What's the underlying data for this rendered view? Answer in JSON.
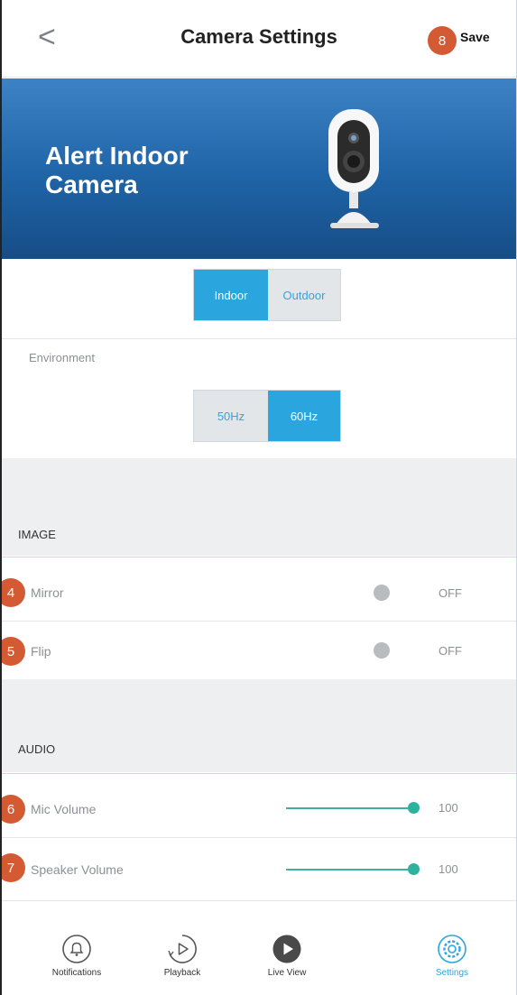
{
  "header": {
    "back_label": "<",
    "title": "Camera Settings",
    "save_label": "Save"
  },
  "callouts": {
    "save": "8",
    "mirror": "4",
    "flip": "5",
    "mic": "6",
    "speaker": "7"
  },
  "banner": {
    "camera_name_line1": "Alert Indoor",
    "camera_name_line2": "Camera",
    "background_color": "#2a6fb0"
  },
  "location": {
    "options": [
      "Indoor",
      "Outdoor"
    ],
    "selected": "Indoor"
  },
  "environment": {
    "label": "Environment",
    "options": [
      "50Hz",
      "60Hz"
    ],
    "selected": "60Hz"
  },
  "image_section": {
    "title": "IMAGE",
    "rows": [
      {
        "label": "Mirror",
        "value": "OFF"
      },
      {
        "label": "Flip",
        "value": "OFF"
      }
    ]
  },
  "audio_section": {
    "title": "AUDIO",
    "rows": [
      {
        "label": "Mic Volume",
        "value": "100",
        "level": 1.0
      },
      {
        "label": "Speaker Volume",
        "value": "100",
        "level": 1.0
      }
    ]
  },
  "tabbar": {
    "tabs": [
      {
        "label": "Notifications",
        "icon": "bell-icon"
      },
      {
        "label": "Playback",
        "icon": "playback-icon"
      },
      {
        "label": "Live View",
        "icon": "play-icon"
      },
      {
        "label": "Settings",
        "icon": "gear-icon"
      }
    ],
    "active": "Settings",
    "accent": "#2aa5dd"
  }
}
